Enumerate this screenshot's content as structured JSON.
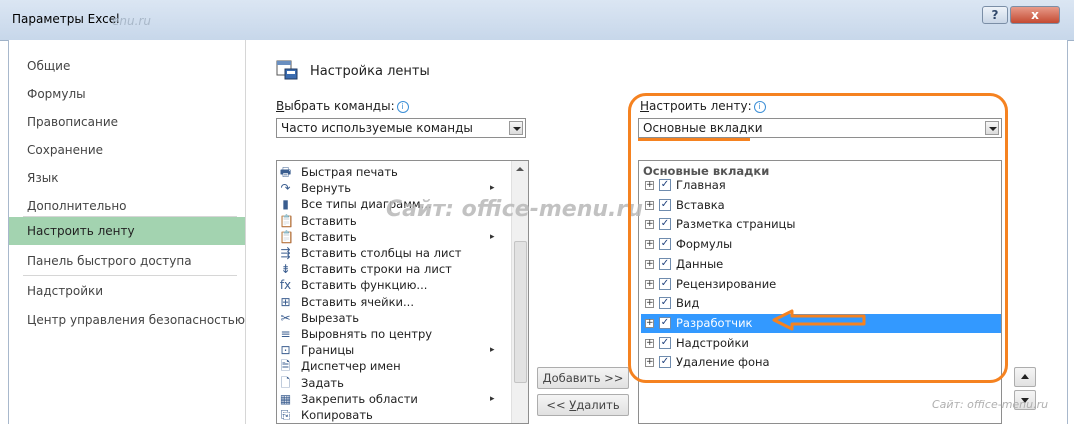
{
  "window": {
    "title": "Параметры Excel",
    "watermark_small": "enu.ru",
    "help_label": "?",
    "close_label": "x"
  },
  "nav": [
    {
      "label": "Общие"
    },
    {
      "label": "Формулы"
    },
    {
      "label": "Правописание"
    },
    {
      "label": "Сохранение"
    },
    {
      "label": "Язык"
    },
    {
      "label": "Дополнительно"
    },
    {
      "label": "Настроить ленту",
      "selected": true
    },
    {
      "label": "Панель быстрого доступа"
    },
    {
      "label": "Надстройки"
    },
    {
      "label": "Центр управления безопасностью"
    }
  ],
  "section": {
    "title": "Настройка ленты"
  },
  "left": {
    "label_underlined": "В",
    "label_rest": "ыбрать команды:",
    "combo_value": "Часто используемые команды",
    "commands": [
      {
        "label": "Быстрая печать",
        "icon": "quick-print-icon",
        "glyph": "🖶",
        "sub": false
      },
      {
        "label": "Вернуть",
        "icon": "redo-icon",
        "glyph": "↷",
        "sub": true
      },
      {
        "label": "Все типы диаграмм...",
        "icon": "chart-icon",
        "glyph": "▮",
        "sub": false
      },
      {
        "label": "Вставить",
        "icon": "paste-icon",
        "glyph": "📋",
        "sub": false
      },
      {
        "label": "Вставить",
        "icon": "paste-icon",
        "glyph": "📋",
        "sub": true
      },
      {
        "label": "Вставить столбцы на лист",
        "icon": "insert-columns-icon",
        "glyph": "⇶",
        "sub": false
      },
      {
        "label": "Вставить строки на лист",
        "icon": "insert-rows-icon",
        "glyph": "⇟",
        "sub": false
      },
      {
        "label": "Вставить функцию...",
        "icon": "function-icon",
        "glyph": "fx",
        "sub": false
      },
      {
        "label": "Вставить ячейки...",
        "icon": "insert-cells-icon",
        "glyph": "⊞",
        "sub": false
      },
      {
        "label": "Вырезать",
        "icon": "cut-icon",
        "glyph": "✂",
        "sub": false
      },
      {
        "label": "Выровнять по центру",
        "icon": "align-center-icon",
        "glyph": "≡",
        "sub": false
      },
      {
        "label": "Границы",
        "icon": "borders-icon",
        "glyph": "⊡",
        "sub": true
      },
      {
        "label": "Диспетчер имен",
        "icon": "name-manager-icon",
        "glyph": "🗎",
        "sub": false
      },
      {
        "label": "Задать",
        "icon": "set-print-area-icon",
        "glyph": "🗋",
        "sub": false
      },
      {
        "label": "Закрепить области",
        "icon": "freeze-panes-icon",
        "glyph": "▦",
        "sub": true
      },
      {
        "label": "Копировать",
        "icon": "copy-icon",
        "glyph": "⎘",
        "sub": false
      }
    ]
  },
  "buttons": {
    "add_underlined": "Д",
    "add_rest": "обавить >>",
    "remove_prefix": "<< ",
    "remove_underlined": "У",
    "remove_rest": "далить"
  },
  "right": {
    "label_underlined": "Н",
    "label_rest": "астроить ленту:",
    "combo_value": "Основные вкладки",
    "tree_header": "Основные вкладки",
    "tabs": [
      {
        "label": "Главная",
        "checked": true
      },
      {
        "label": "Вставка",
        "checked": true
      },
      {
        "label": "Разметка страницы",
        "checked": true
      },
      {
        "label": "Формулы",
        "checked": true
      },
      {
        "label": "Данные",
        "checked": true
      },
      {
        "label": "Рецензирование",
        "checked": true
      },
      {
        "label": "Вид",
        "checked": true
      },
      {
        "label": "Разработчик",
        "checked": true,
        "selected": true
      },
      {
        "label": "Надстройки",
        "checked": true
      },
      {
        "label": "Удаление фона",
        "checked": true
      }
    ]
  },
  "watermark": {
    "big": "Сайт: office-menu.ru",
    "corner": "Сайт: office-menu.ru"
  },
  "colors": {
    "accent_orange": "#f58220",
    "nav_selected": "#a3d3b0",
    "tree_selected": "#3399ff"
  }
}
